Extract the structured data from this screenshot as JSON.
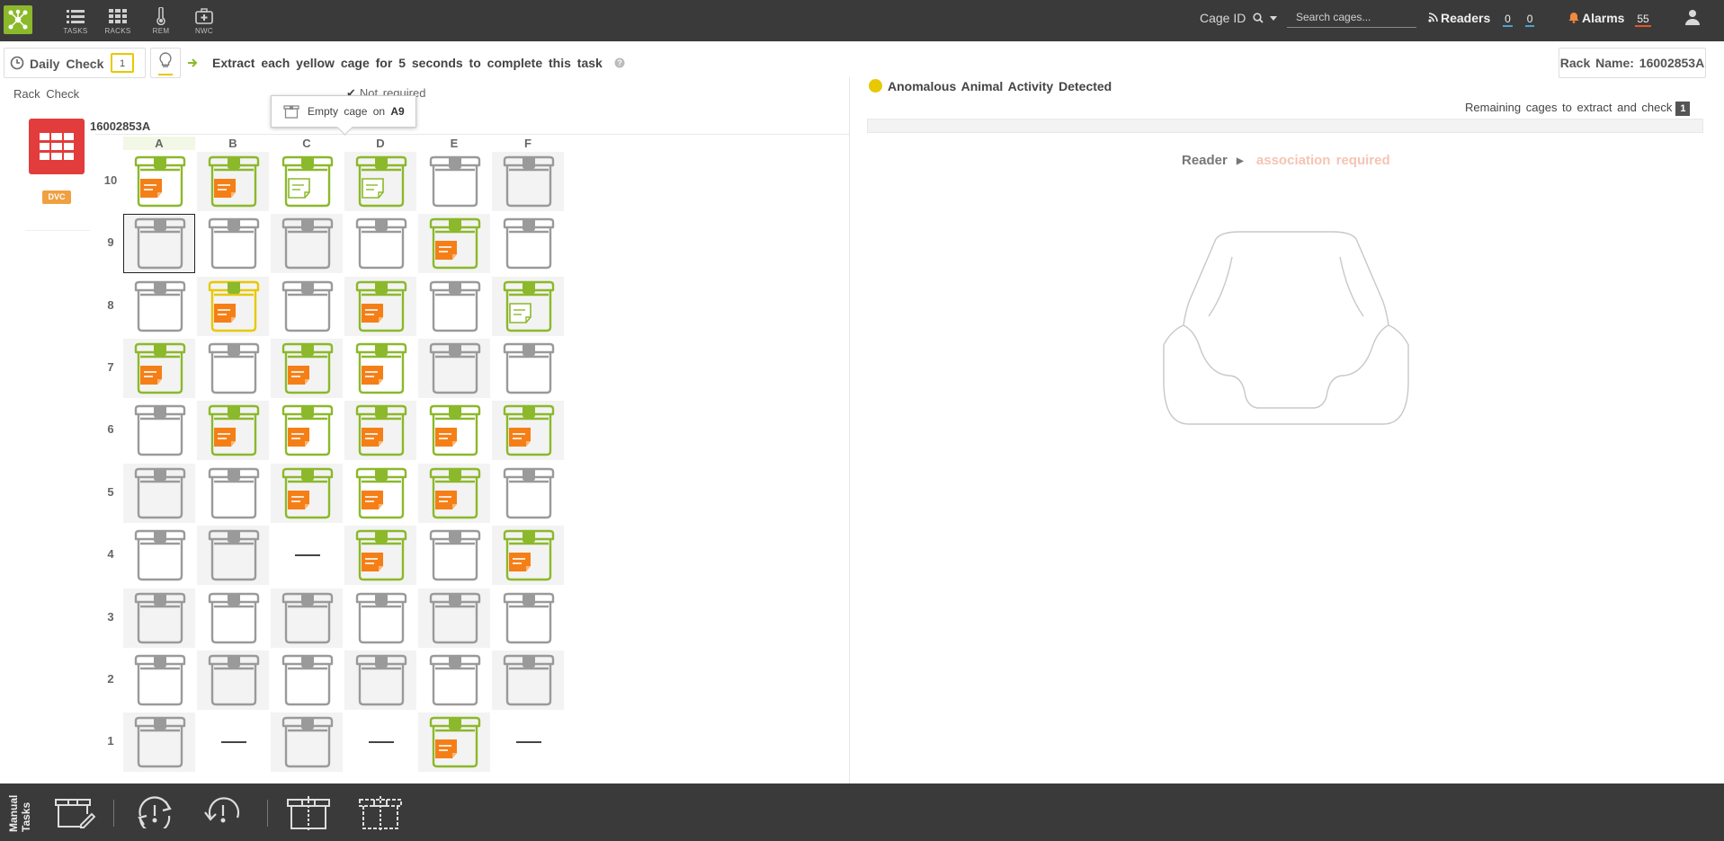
{
  "nav": {
    "items": [
      {
        "label": "TASKS",
        "icon": "tasks-icon"
      },
      {
        "label": "RACKS",
        "icon": "racks-icon"
      },
      {
        "label": "REM",
        "icon": "thermometer-icon"
      },
      {
        "label": "NWC",
        "icon": "medkit-icon"
      }
    ],
    "cage_id_label": "Cage ID",
    "search_placeholder": "Search cages...",
    "readers_label": "Readers",
    "readers_count_1": "0",
    "readers_count_2": "0",
    "alarms_label": "Alarms",
    "alarms_count": "55"
  },
  "task": {
    "daily_check_label": "Daily Check",
    "daily_check_count": "1",
    "instruction": "Extract each yellow cage for 5 seconds to complete this task",
    "rack_name_label": "Rack Name: 16002853A"
  },
  "rack": {
    "rack_check_label": "Rack Check",
    "not_required_label": "Not required",
    "tooltip_prefix": "Empty cage on",
    "tooltip_position": "A9",
    "rack_id": "16002853A",
    "badge": "DVC",
    "columns": [
      "A",
      "B",
      "C",
      "D",
      "E",
      "F"
    ],
    "rows": [
      "10",
      "9",
      "8",
      "7",
      "6",
      "5",
      "4",
      "3",
      "2",
      "1"
    ],
    "cells": [
      [
        "green-orange",
        "green-orange",
        "green-outline",
        "green-outline",
        "empty",
        "empty"
      ],
      [
        "empty",
        "empty",
        "empty",
        "empty",
        "green-orange",
        "empty"
      ],
      [
        "empty",
        "yellow-orange",
        "empty",
        "green-orange",
        "empty",
        "green-outline"
      ],
      [
        "green-orange",
        "empty",
        "green-orange",
        "green-orange",
        "empty",
        "empty"
      ],
      [
        "empty",
        "green-orange",
        "green-orange",
        "green-orange",
        "green-orange",
        "green-orange"
      ],
      [
        "empty",
        "empty",
        "green-orange",
        "green-orange",
        "green-orange",
        "empty"
      ],
      [
        "empty",
        "empty",
        "none",
        "green-orange",
        "empty",
        "green-orange"
      ],
      [
        "empty",
        "empty",
        "empty",
        "empty",
        "empty",
        "empty"
      ],
      [
        "empty",
        "empty",
        "empty",
        "empty",
        "empty",
        "empty"
      ],
      [
        "empty",
        "none",
        "empty",
        "none",
        "green-orange",
        "none"
      ]
    ],
    "selected_cell": "A9"
  },
  "right": {
    "anomalous_label": "Anomalous Animal Activity Detected",
    "remaining_label": "Remaining cages to extract and check",
    "remaining_count": "1",
    "progress": 0,
    "reader_label": "Reader",
    "association_label": "association required"
  },
  "bottom": {
    "manual_tasks_label": "Manual Tasks",
    "tools": [
      "edit-cage-icon",
      "alarm-cycle-icon",
      "undo-alarm-icon",
      "split-cage-icon",
      "split-cage-dotted-icon"
    ]
  },
  "colors": {
    "topbar": "#3a3a3a",
    "accent_green": "#8cb82b",
    "yellow": "#e8c800",
    "orange_card": "#f57f17",
    "empty_cage": "#9a9a9a",
    "rack_icon": "#e23c3c",
    "alarm_underline": "#e2572b",
    "readers_underline": "#4aa0d5"
  }
}
